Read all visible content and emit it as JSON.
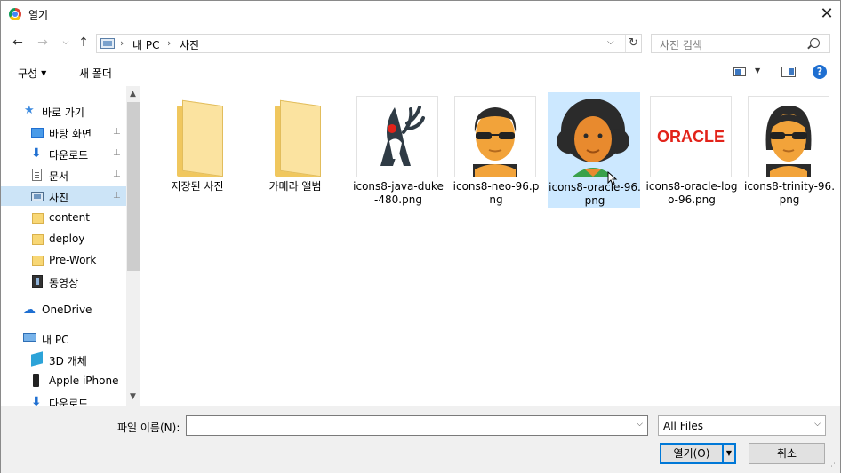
{
  "window": {
    "title": "열기",
    "close_label": "✕"
  },
  "nav": {
    "back": "←",
    "forward": "→",
    "recent": "⌵",
    "up": "↑",
    "breadcrumb": [
      "내 PC",
      "사진"
    ],
    "separator": "›",
    "address_dropdown": "⌵",
    "refresh": "↻",
    "search_placeholder": "사진 검색"
  },
  "commands": {
    "organize": "구성",
    "new_folder": "새 폴더",
    "help": "?"
  },
  "sidebar": {
    "items": [
      {
        "label": "바로 가기",
        "icon": "star-icon"
      },
      {
        "label": "바탕 화면",
        "icon": "desktop-icon",
        "pinned": true
      },
      {
        "label": "다운로드",
        "icon": "download-icon",
        "pinned": true
      },
      {
        "label": "문서",
        "icon": "document-icon",
        "pinned": true
      },
      {
        "label": "사진",
        "icon": "pictures-icon",
        "pinned": true,
        "selected": true
      },
      {
        "label": "content",
        "icon": "folder-icon"
      },
      {
        "label": "deploy",
        "icon": "folder-icon"
      },
      {
        "label": "Pre-Work",
        "icon": "folder-icon"
      },
      {
        "label": "동영상",
        "icon": "video-icon"
      },
      {
        "label": "OneDrive",
        "icon": "cloud-icon"
      },
      {
        "label": "내 PC",
        "icon": "pc-icon"
      },
      {
        "label": "3D 개체",
        "icon": "3d-objects-icon"
      },
      {
        "label": "Apple iPhone",
        "icon": "phone-icon"
      },
      {
        "label": "다운로드",
        "icon": "download-icon"
      }
    ],
    "pin_glyph": "📌"
  },
  "files": [
    {
      "label": "저장된 사진",
      "kind": "folder"
    },
    {
      "label": "카메라 앨범",
      "kind": "folder"
    },
    {
      "label": "icons8-java-duke-480.png",
      "kind": "image",
      "thumb": "duke"
    },
    {
      "label": "icons8-neo-96.png",
      "kind": "image",
      "thumb": "neo"
    },
    {
      "label": "icons8-oracle-96.png",
      "kind": "image",
      "thumb": "oracle-person",
      "selected": true
    },
    {
      "label": "icons8-oracle-logo-96.png",
      "kind": "image",
      "thumb": "oracle-logo"
    },
    {
      "label": "icons8-trinity-96.png",
      "kind": "image",
      "thumb": "trinity"
    }
  ],
  "oracle_logo_text": "ORACLE",
  "bottom": {
    "filename_label": "파일 이름(N):",
    "filename_value": "",
    "filter_value": "All Files",
    "open_button": "열기(O)",
    "cancel_button": "취소"
  },
  "colors": {
    "accent": "#0078d7",
    "selection": "#cce8ff",
    "oracle_red": "#e2231a"
  }
}
